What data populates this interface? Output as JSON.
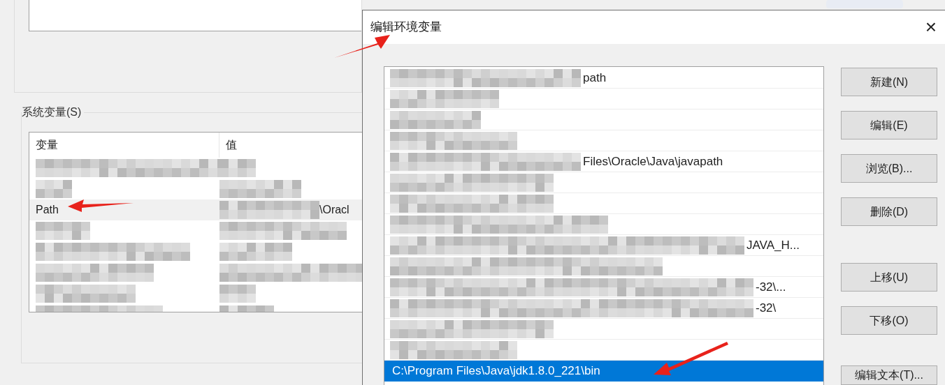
{
  "background_window": {
    "system_variables": {
      "label": "系统变量(S)",
      "columns": [
        "变量",
        "值"
      ],
      "rows": [
        {
          "kind": "redacted",
          "selected": false
        },
        {
          "kind": "redacted",
          "selected": false
        },
        {
          "kind": "text",
          "name": "Path",
          "value": "\\Oracl",
          "selected": true
        },
        {
          "kind": "redacted",
          "selected": false
        },
        {
          "kind": "redacted",
          "selected": false
        },
        {
          "kind": "redacted",
          "selected": false
        },
        {
          "kind": "redacted",
          "selected": false
        },
        {
          "kind": "redacted",
          "selected": false
        }
      ]
    }
  },
  "dialog": {
    "title": "编辑环境变量",
    "close": "×",
    "entries": [
      {
        "kind": "partial",
        "text": "path",
        "selected": false
      },
      {
        "kind": "redacted",
        "selected": false
      },
      {
        "kind": "redacted",
        "selected": false
      },
      {
        "kind": "redacted",
        "selected": false
      },
      {
        "kind": "partial",
        "text": "Files\\Oracle\\Java\\javapath",
        "selected": false
      },
      {
        "kind": "redacted",
        "selected": false
      },
      {
        "kind": "redacted",
        "selected": false
      },
      {
        "kind": "redacted",
        "selected": false
      },
      {
        "kind": "partial",
        "text": "JAVA_H...",
        "selected": false
      },
      {
        "kind": "redacted",
        "selected": false
      },
      {
        "kind": "partial",
        "text": "-32\\...",
        "selected": false
      },
      {
        "kind": "partial",
        "text": "-32\\",
        "selected": false
      },
      {
        "kind": "redacted",
        "selected": false
      },
      {
        "kind": "redacted",
        "selected": false
      },
      {
        "kind": "plain",
        "text": "C:\\Program Files\\Java\\jdk1.8.0_221\\bin",
        "selected": true
      }
    ],
    "button_groups": [
      [
        "新建(N)",
        "编辑(E)",
        "浏览(B)...",
        "删除(D)"
      ],
      [
        "上移(U)",
        "下移(O)"
      ],
      [
        "编辑文本(T)..."
      ]
    ]
  }
}
